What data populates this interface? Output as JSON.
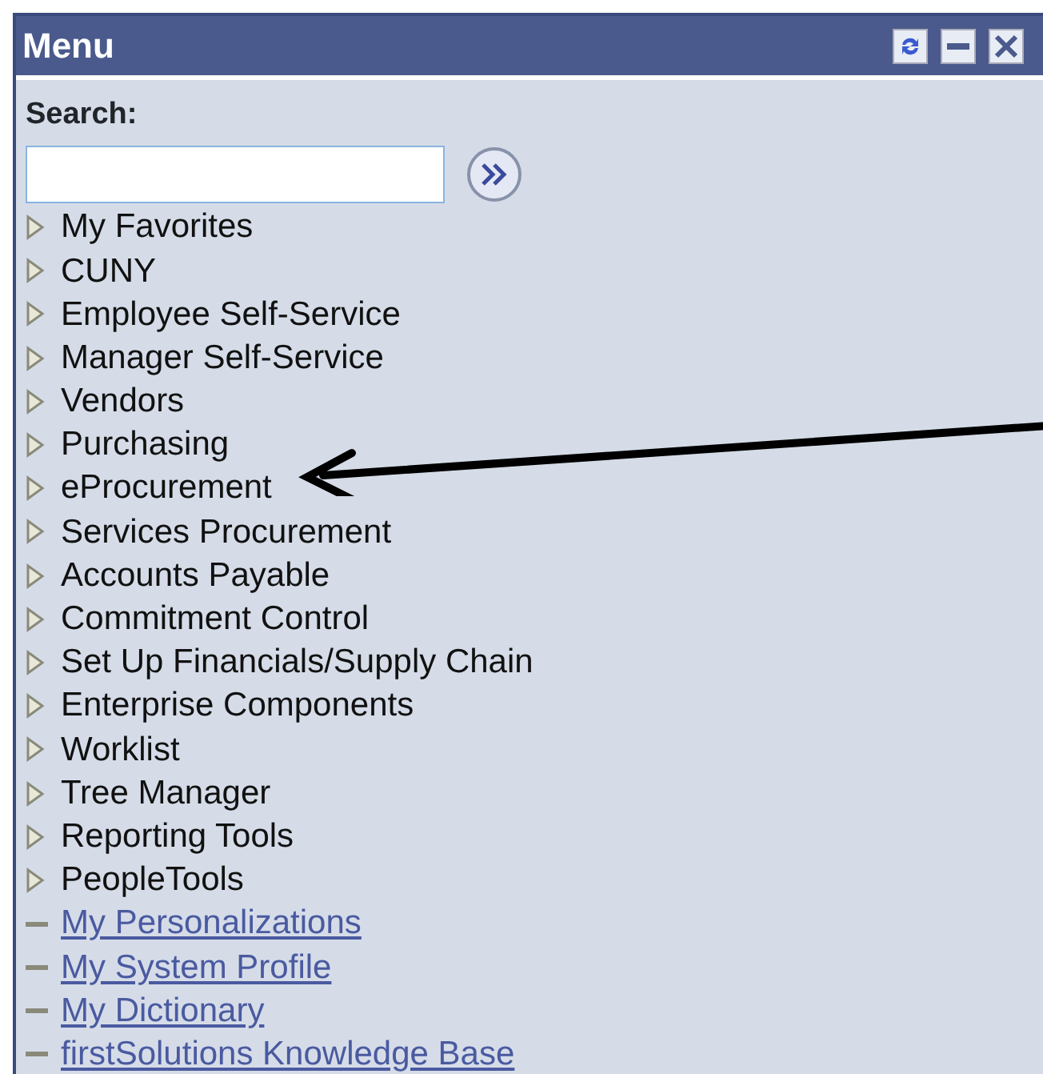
{
  "window": {
    "title": "Menu"
  },
  "search": {
    "label": "Search:"
  },
  "items": [
    {
      "kind": "folder",
      "label": "My Favorites"
    },
    {
      "kind": "folder",
      "label": "CUNY"
    },
    {
      "kind": "folder",
      "label": "Employee Self-Service"
    },
    {
      "kind": "folder",
      "label": "Manager Self-Service"
    },
    {
      "kind": "folder",
      "label": "Vendors"
    },
    {
      "kind": "folder",
      "label": "Purchasing"
    },
    {
      "kind": "folder",
      "label": "eProcurement"
    },
    {
      "kind": "folder",
      "label": "Services Procurement"
    },
    {
      "kind": "folder",
      "label": "Accounts Payable"
    },
    {
      "kind": "folder",
      "label": "Commitment Control"
    },
    {
      "kind": "folder",
      "label": "Set Up Financials/Supply Chain"
    },
    {
      "kind": "folder",
      "label": "Enterprise Components"
    },
    {
      "kind": "folder",
      "label": "Worklist"
    },
    {
      "kind": "folder",
      "label": "Tree Manager"
    },
    {
      "kind": "folder",
      "label": "Reporting Tools"
    },
    {
      "kind": "folder",
      "label": "PeopleTools"
    },
    {
      "kind": "link",
      "label": "My Personalizations"
    },
    {
      "kind": "link",
      "label": "My System Profile"
    },
    {
      "kind": "link",
      "label": "My Dictionary"
    },
    {
      "kind": "link",
      "label": "firstSolutions Knowledge Base"
    }
  ]
}
